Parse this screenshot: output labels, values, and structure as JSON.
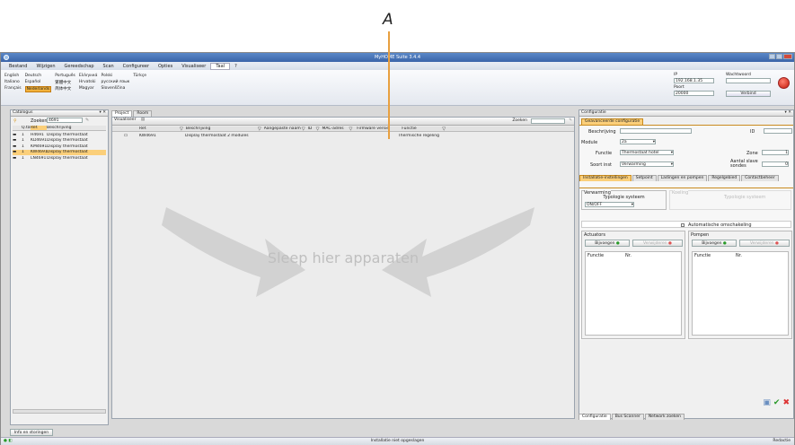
{
  "annotation": {
    "letter": "A"
  },
  "window": {
    "title": "MyHOME Suite 3.4.4"
  },
  "menu": [
    "Bestand",
    "Wijzigen",
    "Gereedschap",
    "Scan",
    "Configureer",
    "Opties",
    "Visualiseer",
    "Taal",
    "?"
  ],
  "languages": [
    [
      "English",
      "Deutsch",
      "Português",
      "Ελληνικά",
      "Polski",
      "Türkçe"
    ],
    [
      "Italiano",
      "Español",
      "繁體中文",
      "Hrvatski",
      "русский язык",
      ""
    ],
    [
      "Français",
      "Nederlands",
      "简体中文",
      "Magyar",
      "Slovenščina",
      ""
    ]
  ],
  "selected_language": "Nederlands",
  "connection": {
    "ip_label": "IP",
    "ip_value": "192.168.1.35",
    "port_label": "Poort",
    "port_value": "20000",
    "password_label": "Wachtwoord",
    "connect_label": "Verbind"
  },
  "catalog": {
    "title": "Catalogus",
    "search_label": "Zoeken",
    "search_value": "4691",
    "headers": [
      "Q.tà",
      "Ref.",
      "Beschrijving"
    ],
    "rows": [
      {
        "qty": "1",
        "ref": "H4691",
        "desc": "Display thermostaat"
      },
      {
        "qty": "1",
        "ref": "KD4691",
        "desc": "Display thermostaat"
      },
      {
        "qty": "1",
        "ref": "KM4691",
        "desc": "Display thermostaat"
      },
      {
        "qty": "1",
        "ref": "KW4691",
        "desc": "Display thermostaat"
      },
      {
        "qty": "1",
        "ref": "LN4691",
        "desc": "Display thermostaat"
      }
    ],
    "info_button": "Info en storingen"
  },
  "project": {
    "tabs": [
      "Project",
      "Room"
    ],
    "view_label": "Visualiseer",
    "search_label": "Zoeken",
    "headers": [
      "Ref.",
      "Beschrijving",
      "Aangepaste naam",
      "ID",
      "MAC-adres",
      "Firmware versie",
      "Functie"
    ],
    "rows": [
      {
        "ref": "KW4691",
        "desc": "Display thermostaat 2 modules",
        "name": "",
        "id": "",
        "mac": "",
        "fw": "",
        "func": "Thermische regeling"
      }
    ],
    "drop_hint": "Sleep hier apparaten"
  },
  "config": {
    "title": "Configuratie",
    "tab_advanced": "Geavanceerde configuratie",
    "beschrijving_label": "Beschrijving",
    "id_label": "ID",
    "module_label": "Module",
    "module_value": "2a",
    "functie_label": "Functie",
    "functie_value": "Thermostaat hotel",
    "zone_label": "Zone",
    "zone_value": "1",
    "soort_label": "Soort inst",
    "soort_value": "Verwarming",
    "slave_label": "Aantal slave sondes",
    "slave_value": "0",
    "subtabs": [
      "Installatie-instellingen",
      "Setpoint",
      "Ladingen en pompen",
      "Regelgebied",
      "Contactbeheer"
    ],
    "heating_group": "Verwarming",
    "cooling_group": "Koeling",
    "typology_label": "Typologie systeem",
    "typology_value": "ON/OFF",
    "typology_cool": "Typologie systeem",
    "auto_switch": "Automatische omschakeling",
    "actuators": "Actuators",
    "pumps": "Pompen",
    "add_label": "Bijvoegen",
    "remove_label": "Verwijderen",
    "col_functie": "Functie",
    "col_nr": "Nr.",
    "bottom_tabs": [
      "Configuratie",
      "Bus Scanner",
      "Network zoeken"
    ]
  },
  "status": {
    "text": "Installatie niet opgeslagen",
    "right": "Redactie"
  }
}
